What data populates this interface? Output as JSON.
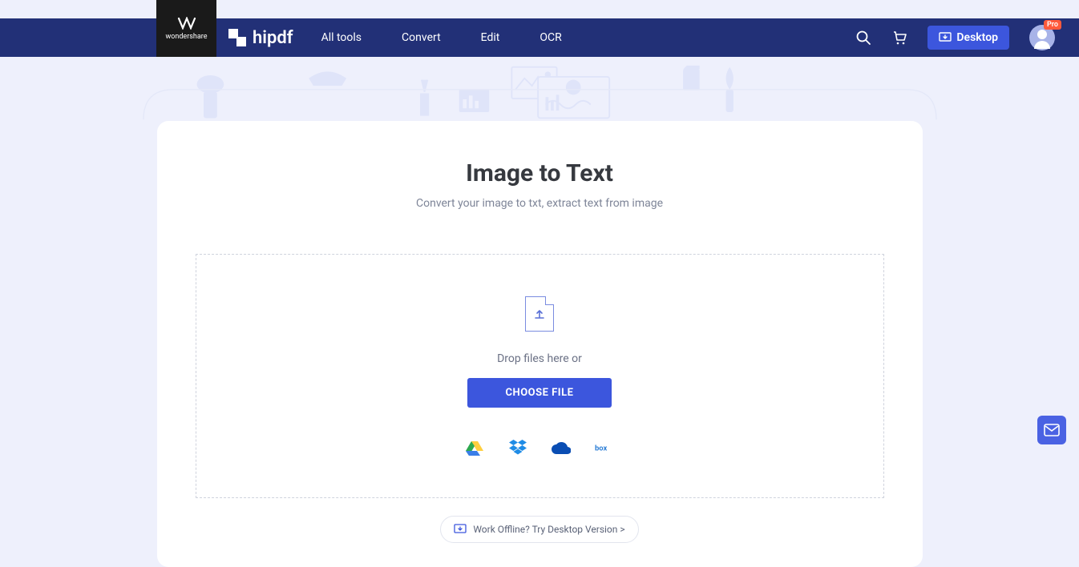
{
  "brand": {
    "parent": "wondershare",
    "name": "hipdf"
  },
  "nav": {
    "items": [
      "All tools",
      "Convert",
      "Edit",
      "OCR"
    ],
    "desktop_label": "Desktop",
    "pro_badge": "Pro"
  },
  "page": {
    "title": "Image to Text",
    "subtitle": "Convert your image to txt, extract text from image"
  },
  "dropzone": {
    "drop_text": "Drop files here or",
    "choose_label": "CHOOSE FILE"
  },
  "cloud_sources": [
    "google-drive",
    "dropbox",
    "onedrive",
    "box"
  ],
  "offline": {
    "text": "Work Offline? Try Desktop Version >"
  }
}
